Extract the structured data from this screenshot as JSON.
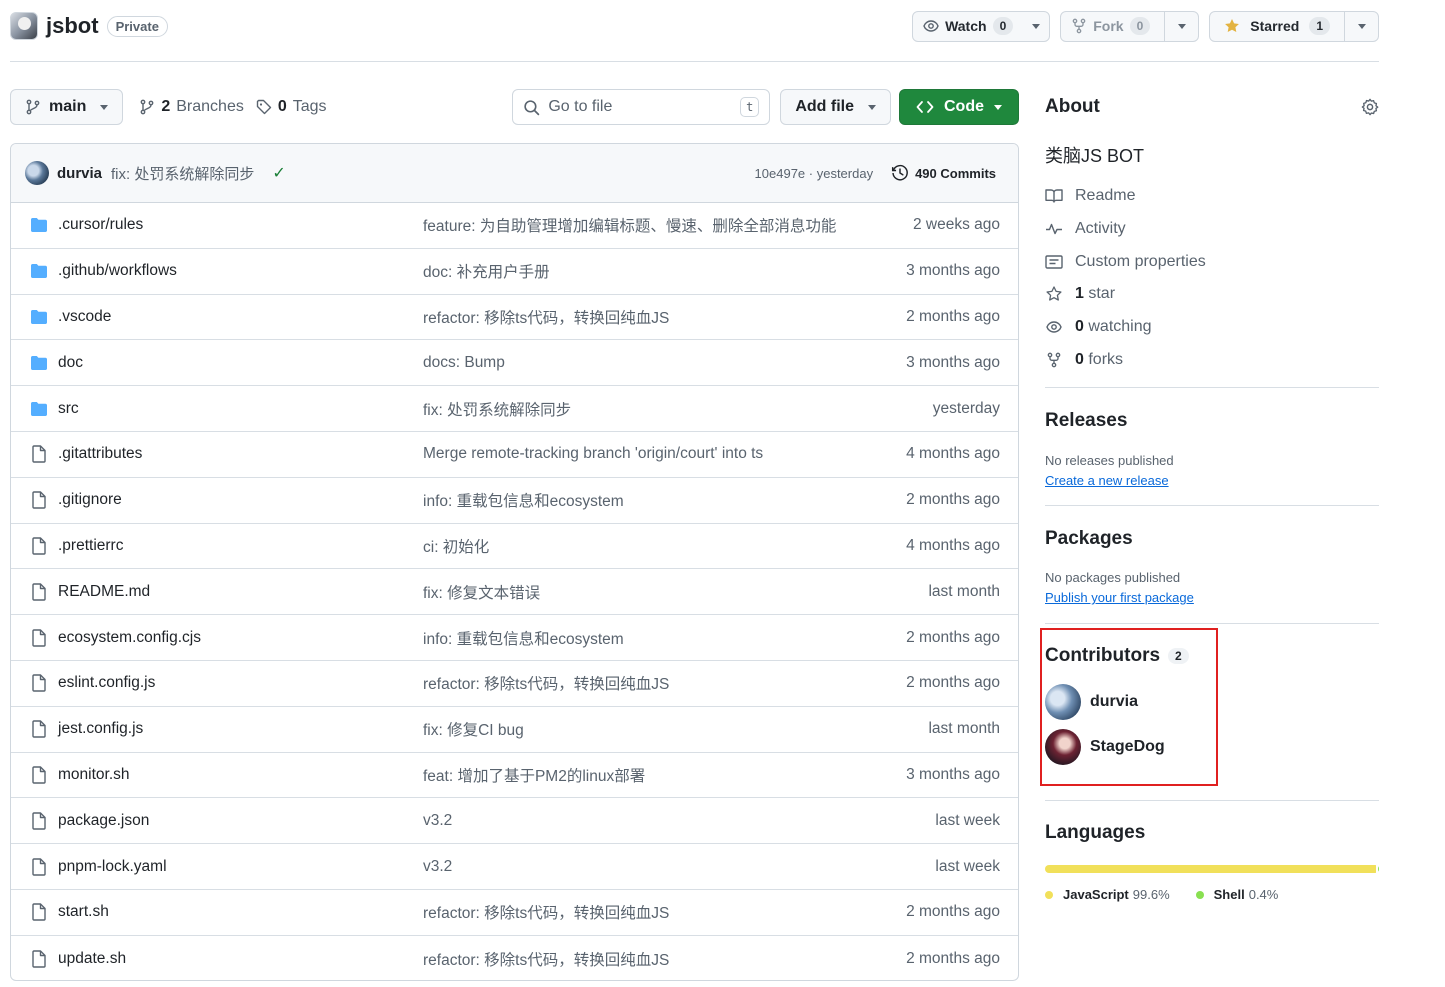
{
  "repo": {
    "name": "jsbot",
    "visibility": "Private",
    "watch": {
      "label": "Watch",
      "count": "0"
    },
    "fork": {
      "label": "Fork",
      "count": "0"
    },
    "star": {
      "label": "Starred",
      "count": "1"
    }
  },
  "toolbar": {
    "branch": "main",
    "branches_count": "2",
    "branches_label": "Branches",
    "tags_count": "0",
    "tags_label": "Tags",
    "search_placeholder": "Go to file",
    "search_shortcut": "t",
    "add_file": "Add file",
    "code": "Code"
  },
  "commit": {
    "author": "durvia",
    "message": "fix: 处罚系统解除同步",
    "meta": "10e497e · yesterday",
    "commits_count": "490 Commits"
  },
  "files": [
    {
      "name": ".cursor/rules",
      "type": "folder",
      "commit": "feature: 为自助管理增加编辑标题、慢速、删除全部消息功能",
      "date": "2 weeks ago"
    },
    {
      "name": ".github/workflows",
      "type": "folder",
      "commit": "doc: 补充用户手册",
      "date": "3 months ago"
    },
    {
      "name": ".vscode",
      "type": "folder",
      "commit": "refactor: 移除ts代码，转换回纯血JS",
      "date": "2 months ago"
    },
    {
      "name": "doc",
      "type": "folder",
      "commit": "docs: Bump",
      "date": "3 months ago"
    },
    {
      "name": "src",
      "type": "folder",
      "commit": "fix: 处罚系统解除同步",
      "date": "yesterday"
    },
    {
      "name": ".gitattributes",
      "type": "file",
      "commit": "Merge remote-tracking branch 'origin/court' into ts",
      "date": "4 months ago"
    },
    {
      "name": ".gitignore",
      "type": "file",
      "commit": "info: 重载包信息和ecosystem",
      "date": "2 months ago"
    },
    {
      "name": ".prettierrc",
      "type": "file",
      "commit": "ci: 初始化",
      "date": "4 months ago"
    },
    {
      "name": "README.md",
      "type": "file",
      "commit": "fix: 修复文本错误",
      "date": "last month"
    },
    {
      "name": "ecosystem.config.cjs",
      "type": "file",
      "commit": "info: 重载包信息和ecosystem",
      "date": "2 months ago"
    },
    {
      "name": "eslint.config.js",
      "type": "file",
      "commit": "refactor: 移除ts代码，转换回纯血JS",
      "date": "2 months ago"
    },
    {
      "name": "jest.config.js",
      "type": "file",
      "commit": "fix: 修复CI bug",
      "date": "last month"
    },
    {
      "name": "monitor.sh",
      "type": "file",
      "commit": "feat: 增加了基于PM2的linux部署",
      "date": "3 months ago"
    },
    {
      "name": "package.json",
      "type": "file",
      "commit": "v3.2",
      "date": "last week"
    },
    {
      "name": "pnpm-lock.yaml",
      "type": "file",
      "commit": "v3.2",
      "date": "last week"
    },
    {
      "name": "start.sh",
      "type": "file",
      "commit": "refactor: 移除ts代码，转换回纯血JS",
      "date": "2 months ago"
    },
    {
      "name": "update.sh",
      "type": "file",
      "commit": "refactor: 移除ts代码，转换回纯血JS",
      "date": "2 months ago"
    }
  ],
  "about": {
    "title": "About",
    "description": "类脑JS BOT",
    "items": [
      {
        "icon": "book-icon",
        "label": "Readme"
      },
      {
        "icon": "pulse-icon",
        "label": "Activity"
      },
      {
        "icon": "note-icon",
        "label": "Custom properties"
      },
      {
        "icon": "star-icon",
        "count": "1",
        "label": "star"
      },
      {
        "icon": "eye-icon",
        "count": "0",
        "label": "watching"
      },
      {
        "icon": "fork-icon",
        "count": "0",
        "label": "forks"
      }
    ]
  },
  "releases": {
    "title": "Releases",
    "empty": "No releases published",
    "link": "Create a new release"
  },
  "packages": {
    "title": "Packages",
    "empty": "No packages published",
    "link": "Publish your first package"
  },
  "contributors": {
    "title": "Contributors",
    "count": "2",
    "people": [
      {
        "name": "durvia"
      },
      {
        "name": "StageDog"
      }
    ]
  },
  "languages": {
    "title": "Languages",
    "items": [
      {
        "name": "JavaScript",
        "percent": "99.6%",
        "value": 99.6,
        "color": "#f1e05a"
      },
      {
        "name": "Shell",
        "percent": "0.4%",
        "value": 0.4,
        "color": "#89e051"
      }
    ]
  },
  "colors": {
    "accent": "#1f883d",
    "link": "#0969da",
    "highlight_box": "#e02020",
    "folder": "#54aeff"
  }
}
